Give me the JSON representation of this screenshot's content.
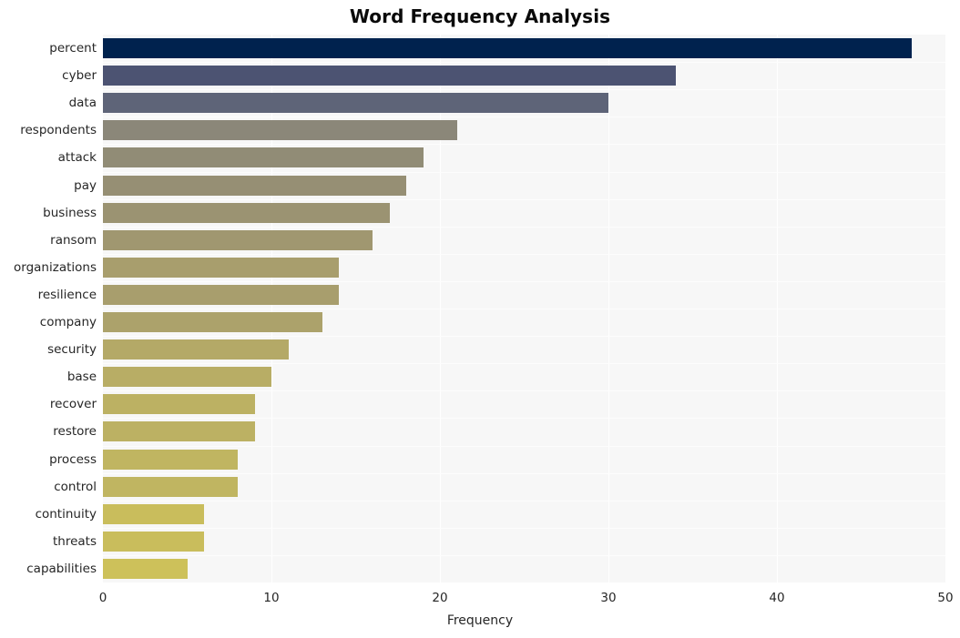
{
  "chart_data": {
    "type": "bar",
    "orientation": "horizontal",
    "title": "Word Frequency Analysis",
    "xlabel": "Frequency",
    "ylabel": "",
    "categories": [
      "percent",
      "cyber",
      "data",
      "respondents",
      "attack",
      "pay",
      "business",
      "ransom",
      "organizations",
      "resilience",
      "company",
      "security",
      "base",
      "recover",
      "restore",
      "process",
      "control",
      "continuity",
      "threats",
      "capabilities"
    ],
    "values": [
      48,
      34,
      30,
      21,
      19,
      18,
      17,
      16,
      14,
      14,
      13,
      11,
      10,
      9,
      9,
      8,
      8,
      6,
      6,
      5
    ],
    "bar_colors": [
      "#00224e",
      "#4c5372",
      "#5e6478",
      "#8b8779",
      "#918c76",
      "#968f74",
      "#9b9372",
      "#a09770",
      "#a89e6d",
      "#a89e6d",
      "#aca26b",
      "#b4a967",
      "#b8ad65",
      "#bcb163",
      "#bcb163",
      "#c0b561",
      "#c0b561",
      "#c9bd5c",
      "#c9bd5c",
      "#cdc15a"
    ],
    "xlim": [
      0,
      50
    ],
    "xticks": [
      0,
      10,
      20,
      30,
      40,
      50
    ],
    "xticklabels": [
      "0",
      "10",
      "20",
      "30",
      "40",
      "50"
    ],
    "grid": true,
    "grid_axis": "x",
    "legend": false,
    "plot_background": "#f7f7f7",
    "figure_background": "#ffffff",
    "gridline_color": "#ffffff",
    "text_color": "#262626",
    "title_color": "#0a0a0a"
  }
}
